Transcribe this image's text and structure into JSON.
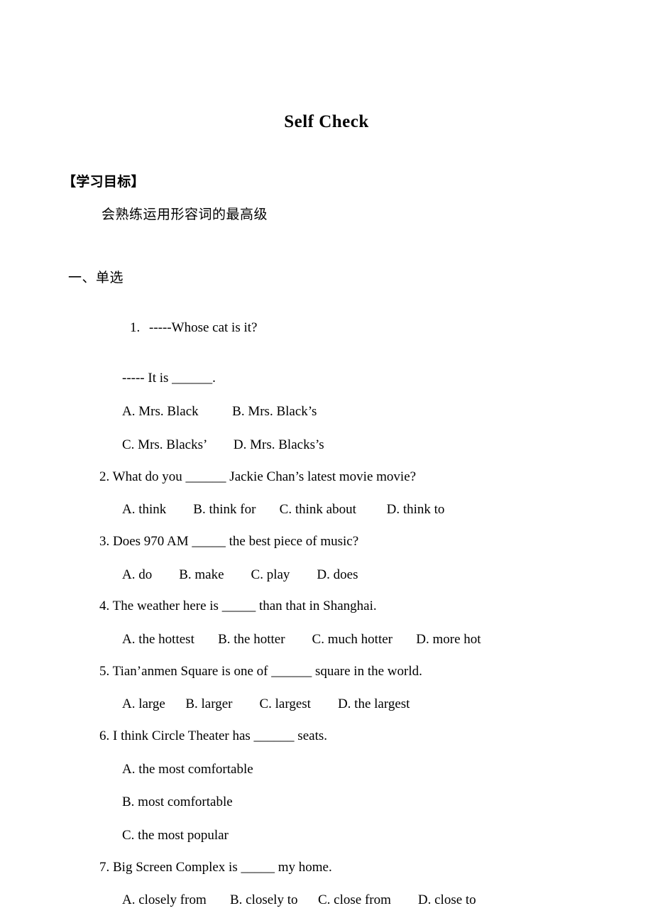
{
  "document": {
    "title": "Self Check",
    "goals": {
      "heading": "【学习目标】",
      "text": "会熟练运用形容词的最高级"
    },
    "section": {
      "heading": "一、单选"
    },
    "questions": [
      {
        "number": "1.",
        "stem": "-----Whose cat is it?",
        "sub": "----- It is ______.",
        "options_line_1": "A. Mrs. Black          B. Mrs. Black’s",
        "options_line_2": "C. Mrs. Blacks’        D. Mrs. Blacks’s"
      },
      {
        "stem": "2. What do you ______ Jackie Chan’s latest movie movie?",
        "options_line_1": "A. think        B. think for       C. think about         D. think to"
      },
      {
        "stem": "3. Does 970 AM _____ the best piece of music?",
        "options_line_1": "A. do        B. make        C. play        D. does"
      },
      {
        "stem": "4. The weather here is _____ than that in Shanghai.",
        "options_line_1": "A. the hottest       B. the hotter        C. much hotter       D. more hot"
      },
      {
        "stem": "5. Tian’anmen Square is one of ______ square in the world.",
        "options_line_1": "A. large      B. larger        C. largest        D. the largest"
      },
      {
        "stem": "6. I think Circle Theater has ______ seats.",
        "options_stacked": [
          "A. the most comfortable",
          "B. most comfortable",
          "C. the most popular"
        ]
      },
      {
        "stem": "7. Big Screen Complex is _____ my home.",
        "options_line_1": "A. closely from       B. closely to      C. close from        D. close to"
      }
    ]
  }
}
